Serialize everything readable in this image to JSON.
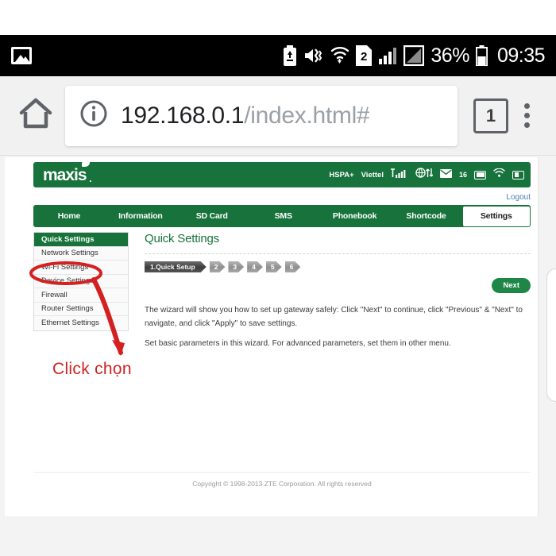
{
  "status_bar": {
    "time": "09:35",
    "battery_percent": "36%",
    "icons": [
      "photo-icon",
      "battery-saver-icon",
      "mute-vibrate-icon",
      "wifi-transfer-icon",
      "sim2-icon",
      "signal-bars-icon",
      "signal-secondary-icon",
      "battery-icon"
    ]
  },
  "browser": {
    "home_icon": "home-icon",
    "info_icon": "info-icon",
    "url_host": "192.168.0.1",
    "url_path": "/index.html#",
    "tab_count": "1",
    "menu_icon": "overflow-menu-icon"
  },
  "router": {
    "brand": "maxis",
    "brand_dot": ".",
    "logout_label": "Logout",
    "signal_info": {
      "network": "HSPA+",
      "carrier": "Viettel",
      "signal_icon": "signal-bars-icon",
      "data_icon": "globe-transfer-icon",
      "mail_icon": "envelope-icon",
      "mail_count": "16",
      "battery_icon": "battery-icon",
      "wifi_icon": "wifi-icon",
      "sim_icon": "sim-card-icon"
    },
    "tabs": [
      {
        "label": "Home",
        "active": false
      },
      {
        "label": "Information",
        "active": false
      },
      {
        "label": "SD Card",
        "active": false
      },
      {
        "label": "SMS",
        "active": false
      },
      {
        "label": "Phonebook",
        "active": false
      },
      {
        "label": "Shortcode",
        "active": false
      },
      {
        "label": "Settings",
        "active": true
      }
    ],
    "sidebar": [
      {
        "label": "Quick Settings",
        "active": true
      },
      {
        "label": "Network Settings",
        "active": false
      },
      {
        "label": "Wi-Fi Settings",
        "active": false
      },
      {
        "label": "Device Settings",
        "active": false
      },
      {
        "label": "Firewall",
        "active": false
      },
      {
        "label": "Router Settings",
        "active": false
      },
      {
        "label": "Ethernet Settings",
        "active": false
      }
    ],
    "content": {
      "title": "Quick Settings",
      "steps": [
        "1.Quick Setup",
        "2",
        "3",
        "4",
        "5",
        "6"
      ],
      "next_label": "Next",
      "paragraph_1": "The wizard will show you how to set up gateway safely: Click \"Next\" to continue, click \"Previous\" & \"Next\" to navigate, and click \"Apply\" to save settings.",
      "paragraph_2": "Set basic parameters in this wizard. For advanced parameters, set them in other menu."
    },
    "copyright": "Copyright © 1998-2013 ZTE Corporation. All rights reserved"
  },
  "annotation": {
    "text": "Click chọn",
    "color": "#cf2222",
    "highlight_target": "Wi-Fi Settings"
  },
  "colors": {
    "brand_green": "#17733b",
    "button_green": "#1e8646",
    "annotation_red": "#cf2222",
    "link_blue": "#4a7fb5"
  }
}
